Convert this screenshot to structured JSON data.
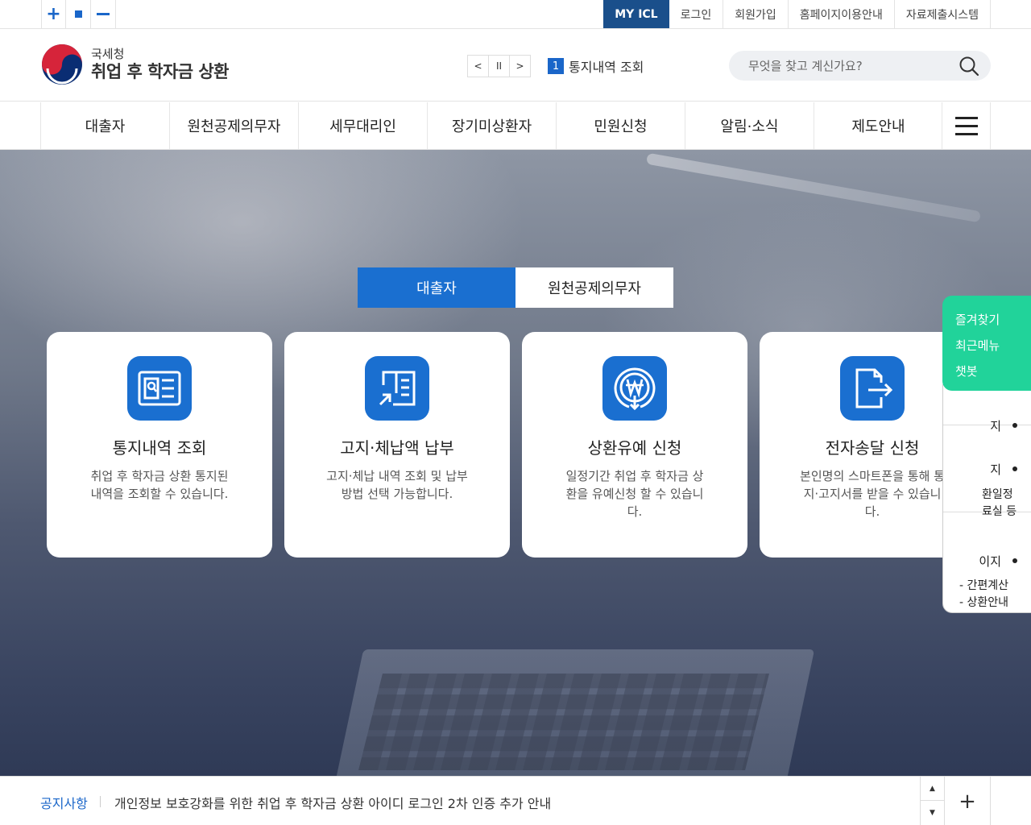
{
  "zoom": {
    "increase_icon": "plus-icon",
    "reset_icon": "square-icon",
    "decrease_icon": "minus-icon"
  },
  "util_links": [
    "MY ICL",
    "로그인",
    "회원가입",
    "홈페이지이용안내",
    "자료제출시스템"
  ],
  "logo": {
    "sub": "국세청",
    "main": "취업 후 학자금 상환"
  },
  "rolling": {
    "prev": "<",
    "pause": "II",
    "next": ">",
    "index": "1",
    "text": "통지내역 조회"
  },
  "search": {
    "placeholder": "무엇을 찾고 계신가요?"
  },
  "gnb": [
    "대출자",
    "원천공제의무자",
    "세무대리인",
    "장기미상환자",
    "민원신청",
    "알림·소식",
    "제도안내"
  ],
  "hero_tabs": [
    "대출자",
    "원천공제의무자"
  ],
  "cards": [
    {
      "title": "통지내역 조회",
      "desc": "취업 후 학자금 상환 통지된 내역을 조회할 수 있습니다.",
      "icon": "document-search-icon"
    },
    {
      "title": "고지·체납액 납부",
      "desc": "고지·체납 내역 조회 및 납부방법 선택 가능합니다.",
      "icon": "document-arrow-icon"
    },
    {
      "title": "상환유예 신청",
      "desc": "일정기간 취업 후 학자금 상환을 유예신청 할 수 있습니다.",
      "icon": "won-coin-icon"
    },
    {
      "title": "전자송달 신청",
      "desc": "본인명의 스마트폰을 통해 통지·고지서를 받을 수 있습니다.",
      "icon": "document-export-icon"
    }
  ],
  "quick": {
    "green": [
      "즐겨찾기",
      "최근메뉴",
      "챗봇"
    ],
    "rows": [
      "지",
      "지",
      "이지"
    ],
    "sub1": [
      "환일정",
      "료실 등"
    ],
    "sub2": [
      "- 간편계산",
      "- 상환안내"
    ]
  },
  "notice": {
    "label": "공지사항",
    "message": "개인정보 보호강화를 위한 취업 후 학자금 상환 아이디 로그인 2차 인증 추가 안내",
    "up": "▲",
    "down": "▼",
    "more": "+"
  },
  "colors": {
    "primary": "#1a6fd0",
    "navy": "#1a4f8b",
    "quick_green": "#21d39a"
  }
}
